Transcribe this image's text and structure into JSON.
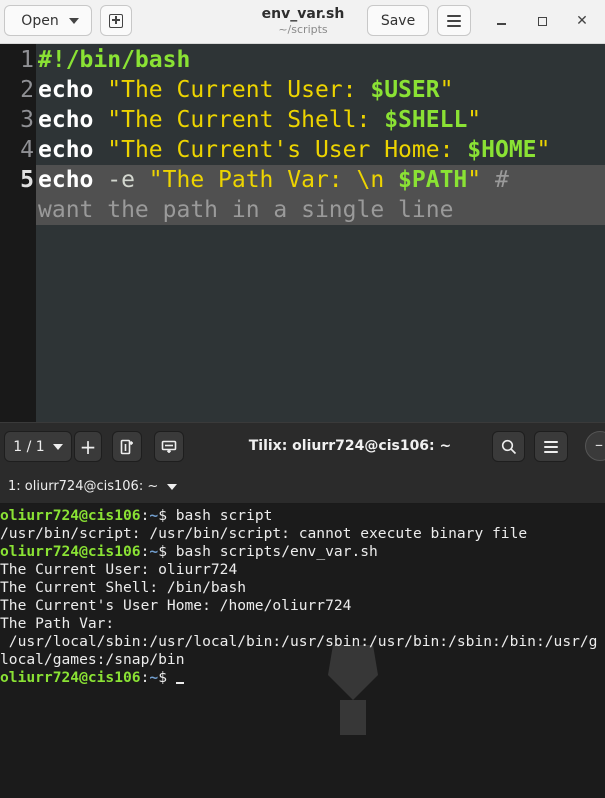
{
  "gedit": {
    "open_label": "Open",
    "file_name": "env_var.sh",
    "file_path": "~/scripts",
    "save_label": "Save",
    "line_numbers": [
      "1",
      "2",
      "3",
      "4",
      "5"
    ],
    "code": {
      "l1": "#!/bin/bash",
      "l2_kw": "echo",
      "l2_str": "\"The Current User: ",
      "l2_var": "$USER",
      "l2_end": "\"",
      "l3_kw": "echo",
      "l3_str": "\"The Current Shell: ",
      "l3_var": "$SHELL",
      "l3_end": "\"",
      "l4_kw": "echo",
      "l4_str": "\"The Current's User Home: ",
      "l4_var": "$HOME",
      "l4_end": "\"",
      "l5_kw": "echo",
      "l5_opt": " -e ",
      "l5_str": "\"The Path Var: \\n ",
      "l5_var": "$PATH",
      "l5_end": "\"",
      "l5_cmt": " #",
      "l5_wrap": "want the path in a single line"
    }
  },
  "tilix": {
    "session_label": "1 / 1",
    "title": "Tilix: oliurr724@cis106: ~",
    "tab_label": "1: oliurr724@cis106: ~",
    "terminal": {
      "prompt_user": "oliurr724@cis106",
      "prompt_sep": ":",
      "prompt_path": "~",
      "prompt_sym": "$ ",
      "cmd1": "bash script",
      "out1": "/usr/bin/script: /usr/bin/script: cannot execute binary file",
      "cmd2": "bash scripts/env_var.sh",
      "out2": "The Current User: oliurr724",
      "out3": "The Current Shell: /bin/bash",
      "out4": "The Current's User Home: /home/oliurr724",
      "out5": "The Path Var:",
      "out6": " /usr/local/sbin:/usr/local/bin:/usr/sbin:/usr/bin:/sbin:/bin:/usr/g",
      "out7": "local/games:/snap/bin"
    }
  },
  "colors": {
    "editor_bg": "#2e3436",
    "keyword": "#ffffff",
    "string": "#edd400",
    "variable": "#8ae234",
    "comment": "#9a9a9a",
    "prompt_user": "#8ae234",
    "prompt_path": "#729fcf",
    "terminal_bg": "#1b1b1b"
  },
  "icons": [
    "caret-down-icon",
    "new-tab-icon",
    "hamburger-menu-icon",
    "minimize-icon",
    "maximize-icon",
    "close-icon",
    "add-terminal-icon",
    "split-right-icon",
    "split-down-icon",
    "search-icon"
  ]
}
